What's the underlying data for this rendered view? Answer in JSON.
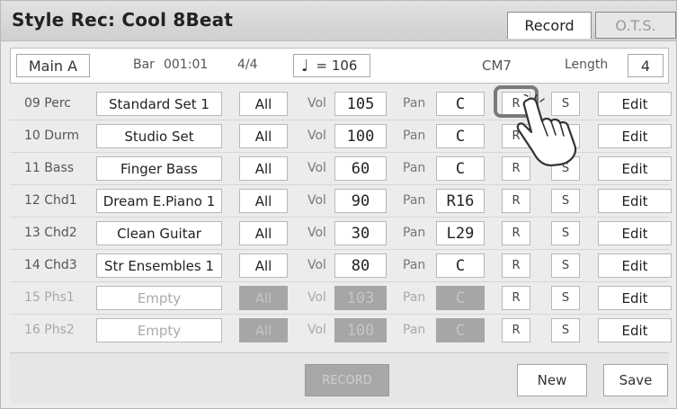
{
  "window": {
    "title": "Style Rec: Cool 8Beat",
    "tabs": [
      {
        "label": "Record",
        "active": true
      },
      {
        "label": "O.T.S.",
        "active": false
      }
    ]
  },
  "info": {
    "section": "Main A",
    "bar_label": "Bar",
    "bar_value": "001:01",
    "time_signature": "4/4",
    "tempo_symbol": "♩",
    "tempo_value": "= 106",
    "chord": "CM7",
    "length_label": "Length",
    "length_value": "4"
  },
  "labels": {
    "vol": "Vol",
    "pan": "Pan",
    "record_button": "R",
    "solo_button": "S",
    "edit_button": "Edit"
  },
  "tracks": [
    {
      "id": "09 Perc",
      "voice": "Standard Set 1",
      "part": "All",
      "vol": "105",
      "pan": "C",
      "enabled": true
    },
    {
      "id": "10 Durm",
      "voice": "Studio Set",
      "part": "All",
      "vol": "100",
      "pan": "C",
      "enabled": true
    },
    {
      "id": "11 Bass",
      "voice": "Finger Bass",
      "part": "All",
      "vol": "60",
      "pan": "C",
      "enabled": true
    },
    {
      "id": "12 Chd1",
      "voice": "Dream E.Piano 1",
      "part": "All",
      "vol": "90",
      "pan": "R16",
      "enabled": true
    },
    {
      "id": "13 Chd2",
      "voice": "Clean Guitar",
      "part": "All",
      "vol": "30",
      "pan": "L29",
      "enabled": true
    },
    {
      "id": "14 Chd3",
      "voice": "Str Ensembles 1",
      "part": "All",
      "vol": "80",
      "pan": "C",
      "enabled": true
    },
    {
      "id": "15 Phs1",
      "voice": "Empty",
      "part": "All",
      "vol": "103",
      "pan": "C",
      "enabled": false
    },
    {
      "id": "16 Phs2",
      "voice": "Empty",
      "part": "All",
      "vol": "100",
      "pan": "C",
      "enabled": false
    }
  ],
  "footer": {
    "record": "RECORD",
    "new": "New",
    "save": "Save"
  },
  "colors": {
    "panel_bg": "#ececec",
    "disabled_fill": "#a6a6a6",
    "title_text": "#222222"
  },
  "overlay": {
    "pointer": "hand-pointer-icon",
    "highlighted": "record-button-track-09"
  }
}
